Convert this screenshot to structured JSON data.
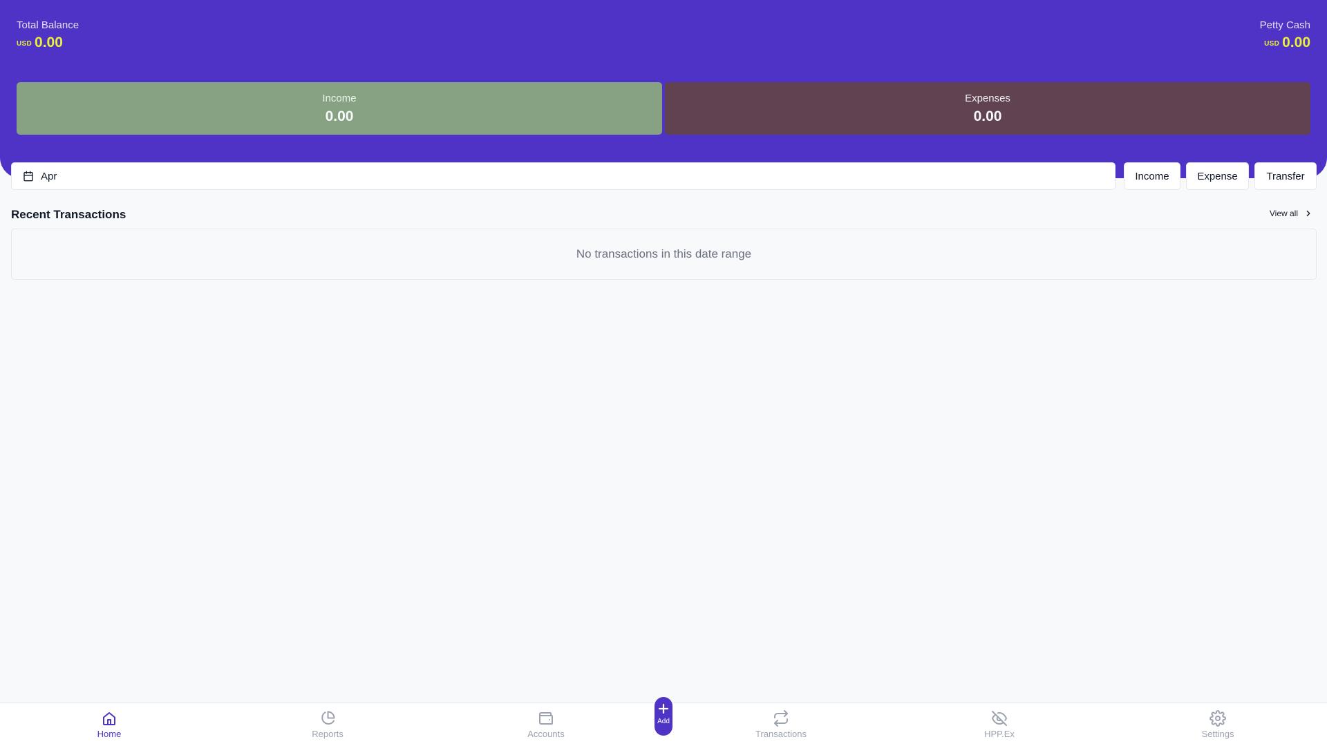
{
  "header": {
    "total_balance": {
      "label": "Total Balance",
      "currency": "USD",
      "amount": "0.00"
    },
    "petty_cash": {
      "label": "Petty Cash",
      "currency": "USD",
      "amount": "0.00"
    },
    "income": {
      "label": "Income",
      "amount": "0.00"
    },
    "expenses": {
      "label": "Expenses",
      "amount": "0.00"
    }
  },
  "toolbar": {
    "date_value": "Apr",
    "income_label": "Income",
    "expense_label": "Expense",
    "transfer_label": "Transfer"
  },
  "recent": {
    "title": "Recent Transactions",
    "view_all_label": "View all",
    "empty_message": "No transactions in this date range"
  },
  "nav": {
    "items": [
      {
        "label": "Home",
        "icon": "home-icon",
        "active": true
      },
      {
        "label": "Reports",
        "icon": "pie-chart-icon"
      },
      {
        "label": "Accounts",
        "icon": "wallet-icon"
      },
      {
        "label": "Transactions",
        "icon": "repeat-icon"
      },
      {
        "label": "HPP.Ex",
        "icon": "eye-off-icon"
      },
      {
        "label": "Settings",
        "icon": "gear-icon"
      }
    ],
    "add_label": "Add"
  },
  "colors": {
    "brand": "#4f33c6",
    "income_card": "#87a283",
    "expense_card": "#604251",
    "amount_highlight": "#ecef3a"
  }
}
